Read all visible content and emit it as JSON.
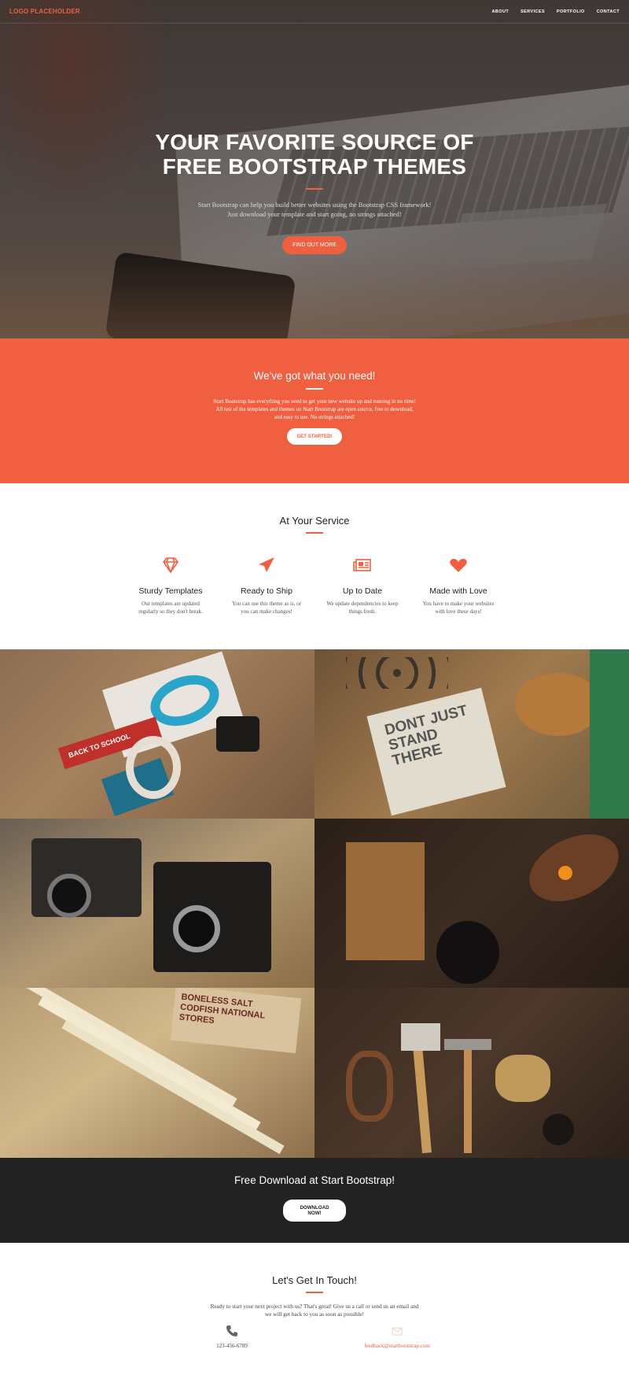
{
  "nav": {
    "logo": "LOGO PLACEHOLDER",
    "links": [
      "ABOUT",
      "SERVICES",
      "PORTFOLIO",
      "CONTACT"
    ]
  },
  "hero": {
    "title_line1": "YOUR FAVORITE SOURCE OF",
    "title_line2": "FREE BOOTSTRAP THEMES",
    "text_line1": "Start Bootstrap can help you build better websites using the Bootstrap CSS framework!",
    "text_line2": "Just download your template and start going, no strings attached!",
    "button": "FIND OUT MORE"
  },
  "about": {
    "title": "We've got what you need!",
    "text_line1": "Start Bootstrap has everything you need to get your new website up and running in no time!",
    "text_line2": "All test of the templates and themes on Start Bootstrap are open source, free to download,",
    "text_line3": "and easy to use. No strings attached!",
    "button": "GET STARTED!"
  },
  "services": {
    "title": "At Your Service",
    "items": [
      {
        "icon": "diamond-icon",
        "title": "Sturdy Templates",
        "text_line1": "Our templates are updated",
        "text_line2": "regularly so they don't break."
      },
      {
        "icon": "paper-plane-icon",
        "title": "Ready to Ship",
        "text_line1": "You can use this theme as is, or",
        "text_line2": "you can make changes!"
      },
      {
        "icon": "newspaper-icon",
        "title": "Up to Date",
        "text_line1": "We update dependencies to keep",
        "text_line2": "things fresh."
      },
      {
        "icon": "heart-icon",
        "title": "Made with Love",
        "text_line1": "You have to make your websites",
        "text_line2": "with love these days!"
      }
    ]
  },
  "portfolio": {
    "tile_texts": [
      "BACK TO SCHOOL",
      "DONT JUST STAND THERE",
      "BONELESS SALT CODFISH NATIONAL STORES"
    ]
  },
  "download": {
    "title": "Free Download at Start Bootstrap!",
    "button": "DOWNLOAD NOW!"
  },
  "contact": {
    "title": "Let's Get In Touch!",
    "text_line1": "Ready to start your next project with us? That's great! Give us a call or send us an email and",
    "text_line2": "we will get back to you as soon as possible!",
    "phone": "123-456-6789",
    "email": "feedback@startbootstrap.com"
  },
  "colors": {
    "accent": "#f05f40",
    "dark": "#222222",
    "white": "#ffffff"
  }
}
